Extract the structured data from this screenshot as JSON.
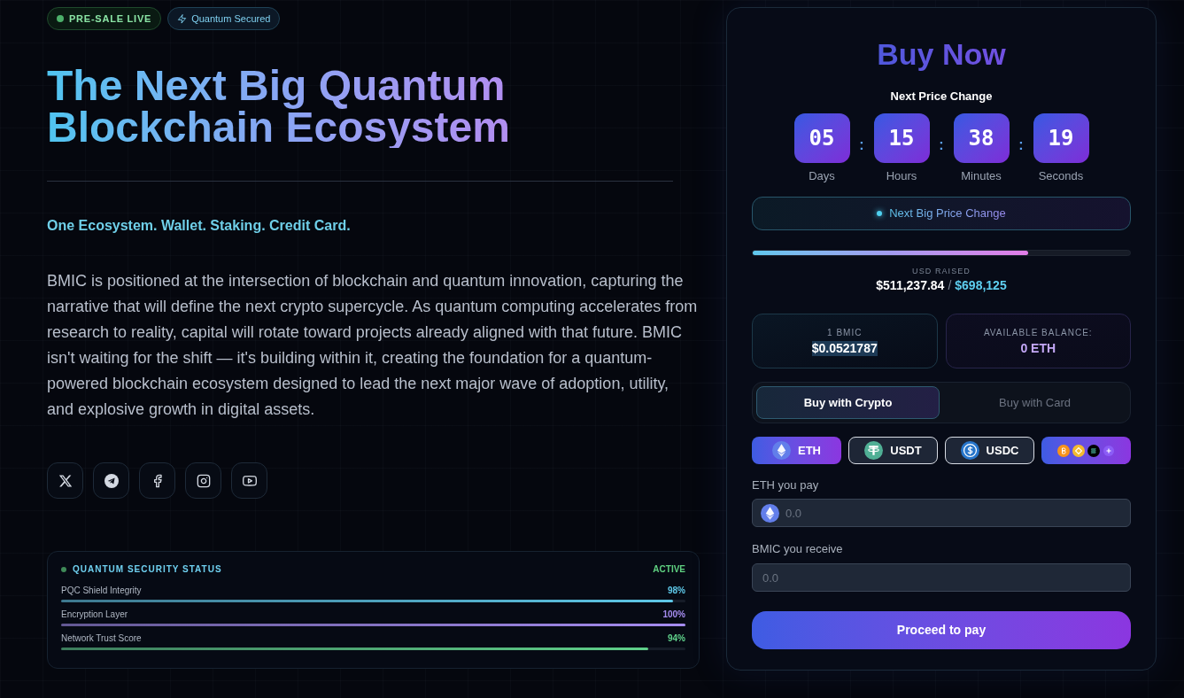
{
  "badges": [
    {
      "kind": "live",
      "label": "PRE-SALE LIVE"
    },
    {
      "kind": "secured",
      "label": "Quantum Secured"
    }
  ],
  "hero": {
    "title": "The Next Big Quantum Blockchain Ecosystem",
    "tagline": "One Ecosystem. Wallet. Staking. Credit Card.",
    "description": "BMIC is positioned at the intersection of blockchain and quantum innovation, capturing the narrative that will define the next crypto supercycle. As quantum computing accelerates from research to reality, capital will rotate toward projects already aligned with that future. BMIC isn't waiting for the shift — it's building within it, creating the foundation for a quantum-powered blockchain ecosystem designed to lead the next major wave of adoption, utility, and explosive growth in digital assets."
  },
  "social_links": [
    {
      "kind": "x"
    },
    {
      "kind": "telegram"
    },
    {
      "kind": "facebook"
    },
    {
      "kind": "instagram"
    },
    {
      "kind": "youtube"
    }
  ],
  "security_status": {
    "title": "QUANTUM SECURITY STATUS",
    "status": "ACTIVE",
    "metrics": [
      {
        "label": "PQC Shield Integrity",
        "value": "98%",
        "level": 0.98,
        "color": "#5ec8e8"
      },
      {
        "label": "Encryption Layer",
        "value": "100%",
        "level": 1.0,
        "color": "#a58cf0"
      },
      {
        "label": "Network Trust Score",
        "value": "94%",
        "level": 0.94,
        "color": "#5fd08a"
      }
    ]
  },
  "buy_panel": {
    "title": "Buy Now",
    "countdown": {
      "title": "Next Price Change",
      "units": [
        {
          "value": "05",
          "label": "Days",
          "separator": ":"
        },
        {
          "value": "15",
          "label": "Hours",
          "separator": ":"
        },
        {
          "value": "38",
          "label": "Minutes",
          "separator": ":"
        },
        {
          "value": "19",
          "label": "Seconds"
        }
      ]
    },
    "notice": "Next Big Price Change",
    "progress": {
      "level": 0.73
    },
    "raised": {
      "label": "USD RAISED",
      "amount": "$511,237.84",
      "separator": "/",
      "target": "$698,125"
    },
    "price": {
      "label": "1 BMIC",
      "value": "$0.0521787"
    },
    "balance": {
      "label": "AVAILABLE BALANCE:",
      "value": "0 ETH"
    },
    "payment_tabs": [
      {
        "label": "Buy with Crypto",
        "selected": true
      },
      {
        "label": "Buy with Card",
        "selected": false
      }
    ],
    "currencies": [
      {
        "kind": "eth",
        "label": "ETH",
        "selected": true
      },
      {
        "kind": "usdt",
        "label": "USDT",
        "selected": false
      },
      {
        "kind": "usdc",
        "label": "USDC",
        "selected": false
      },
      {
        "kind": "more",
        "selected": false
      }
    ],
    "pay_field": {
      "label": "ETH you pay",
      "placeholder": "0.0"
    },
    "receive_field": {
      "label": "BMIC you receive",
      "placeholder": "0.0"
    },
    "submit": "Proceed to pay"
  }
}
